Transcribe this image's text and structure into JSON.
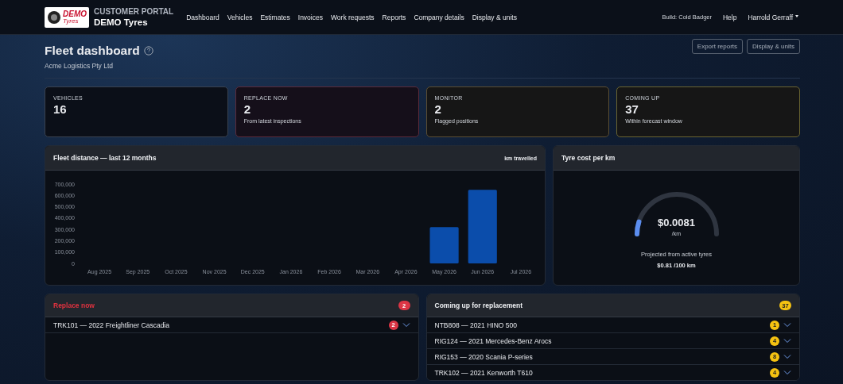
{
  "navbar": {
    "logo": {
      "word_1": "DEMO",
      "word_2": "Tyres"
    },
    "portal_label": "CUSTOMER PORTAL",
    "company": "DEMO Tyres",
    "links": [
      {
        "label": "Dashboard"
      },
      {
        "label": "Vehicles"
      },
      {
        "label": "Estimates"
      },
      {
        "label": "Invoices"
      },
      {
        "label": "Work requests"
      },
      {
        "label": "Reports"
      },
      {
        "label": "Company details"
      },
      {
        "label": "Display & units"
      }
    ],
    "build": "Build: Cold Badger",
    "help": "Help",
    "user": "Harrold Gerraff"
  },
  "header": {
    "title": "Fleet dashboard",
    "subtitle": "Acme Logistics Pty Ltd",
    "buttons": [
      "Export reports",
      "Display & units"
    ]
  },
  "stats": [
    {
      "label": "VEHICLES",
      "value": "16",
      "kind": "neutral"
    },
    {
      "label": "REPLACE NOW",
      "value": "2",
      "note": "From latest inspections",
      "kind": "danger"
    },
    {
      "label": "MONITOR",
      "value": "2",
      "note": "Flagged positions",
      "kind": "warn"
    },
    {
      "label": "COMING UP",
      "value": "37",
      "note": "Within forecast window",
      "kind": "soon"
    }
  ],
  "distance_panel": {
    "title": "Fleet distance — last 12 months",
    "chart_data": {
      "type": "bar",
      "categories": [
        "Aug 2025",
        "Sep 2025",
        "Oct 2025",
        "Nov 2025",
        "Dec 2025",
        "Jan 2026",
        "Feb 2026",
        "Mar 2026",
        "Apr 2026",
        "May 2026",
        "Jun 2026",
        "Jul 2026"
      ],
      "series": [
        {
          "name": "km travelled",
          "color": "#0b4dab",
          "values": [
            null,
            null,
            null,
            null,
            null,
            null,
            null,
            null,
            null,
            320000,
            650000,
            null
          ]
        }
      ],
      "ylim": [
        0,
        700000
      ],
      "yticks": [
        {
          "value": 0,
          "label": "0"
        },
        {
          "value": 100000,
          "label": "100,000"
        },
        {
          "value": 200000,
          "label": "200,000"
        },
        {
          "value": 300000,
          "label": "300,000"
        },
        {
          "value": 400000,
          "label": "400,000"
        },
        {
          "value": 500000,
          "label": "500,000"
        },
        {
          "value": 600000,
          "label": "600,000"
        },
        {
          "value": 700000,
          "label": "700,000"
        }
      ]
    }
  },
  "cost_panel": {
    "title": "Tyre cost per km",
    "gauge": {
      "value": "$0.0081",
      "unit": "/km"
    },
    "note": "Projected from active tyres",
    "per_100": "$0.81 /100 km"
  },
  "replace_panel": {
    "title": "Replace now",
    "count": "2",
    "kind": "danger",
    "rows": [
      {
        "label": "TRK101 — 2022 Freightliner Cascadia",
        "count": "2",
        "expanded": false
      }
    ]
  },
  "coming_panel": {
    "title": "Coming up for replacement",
    "count": "37",
    "kind": "soon",
    "rows": [
      {
        "label": "NTB808 — 2021 HINO 500",
        "count": "1",
        "expanded": false
      },
      {
        "label": "RIG124 — 2021 Mercedes-Benz Arocs",
        "count": "4",
        "expanded": false
      },
      {
        "label": "RIG153 — 2020 Scania P-series",
        "count": "8",
        "expanded": false
      },
      {
        "label": "TRK102 — 2021 Kenworth T610",
        "count": "4",
        "expanded": false
      }
    ]
  }
}
